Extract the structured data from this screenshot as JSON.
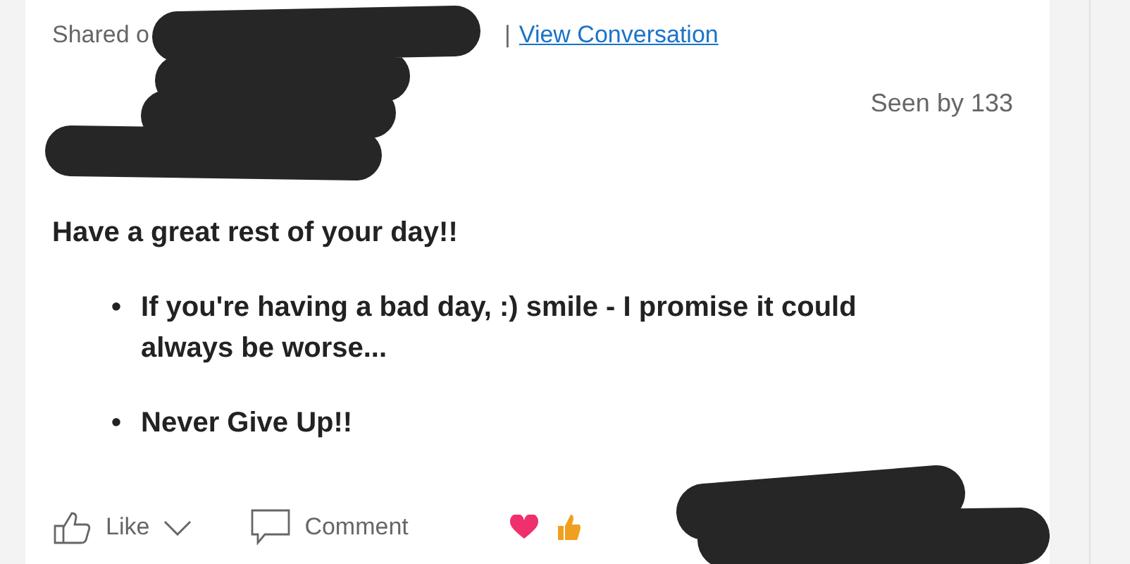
{
  "share_line": {
    "prefix": "Shared o",
    "separator": "|",
    "link": "View Conversation"
  },
  "seen_by": "Seen by 133",
  "post": {
    "heading": "Have a great rest of your day!!",
    "bullets": [
      {
        "marker": "•",
        "text": "If you're having a bad day, :) smile - I promise it could always be worse..."
      },
      {
        "marker": "•",
        "text": "Never Give Up!!"
      }
    ]
  },
  "actions": [
    {
      "kind": "like",
      "label": "Like"
    },
    {
      "kind": "comment",
      "label": "Comment"
    }
  ],
  "reactions": [
    {
      "kind": "heart"
    },
    {
      "kind": "thumb"
    }
  ]
}
